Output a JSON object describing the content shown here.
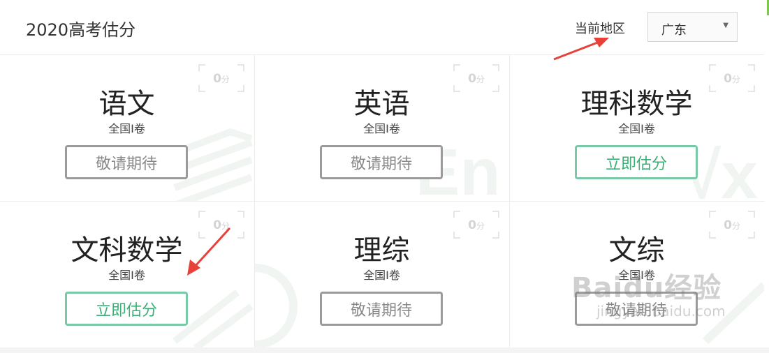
{
  "header": {
    "title": "2020高考估分",
    "region_label": "当前地区",
    "region_value": "广东"
  },
  "cards": [
    {
      "subject": "语文",
      "paper": "全国I卷",
      "score": "0",
      "unit": "分",
      "button": "敬请期待",
      "button_state": "disabled"
    },
    {
      "subject": "英语",
      "paper": "全国I卷",
      "score": "0",
      "unit": "分",
      "button": "敬请期待",
      "button_state": "disabled"
    },
    {
      "subject": "理科数学",
      "paper": "全国I卷",
      "score": "0",
      "unit": "分",
      "button": "立即估分",
      "button_state": "active"
    },
    {
      "subject": "文科数学",
      "paper": "全国I卷",
      "score": "0",
      "unit": "分",
      "button": "立即估分",
      "button_state": "active"
    },
    {
      "subject": "理综",
      "paper": "全国I卷",
      "score": "0",
      "unit": "分",
      "button": "敬请期待",
      "button_state": "disabled"
    },
    {
      "subject": "文综",
      "paper": "全国I卷",
      "score": "0",
      "unit": "分",
      "button": "敬请期待",
      "button_state": "disabled"
    }
  ],
  "watermark": {
    "brand": "Baidu经验",
    "url": "jingyan.baidu.com"
  },
  "colors": {
    "active_green": "#3cae76",
    "active_border": "#79c8a6",
    "disabled_gray": "#888888",
    "annotation_red": "#e8413a"
  },
  "icons": {
    "region_caret": "triangle-down-icon",
    "annotation_arrow": "red-arrow-annotation"
  }
}
